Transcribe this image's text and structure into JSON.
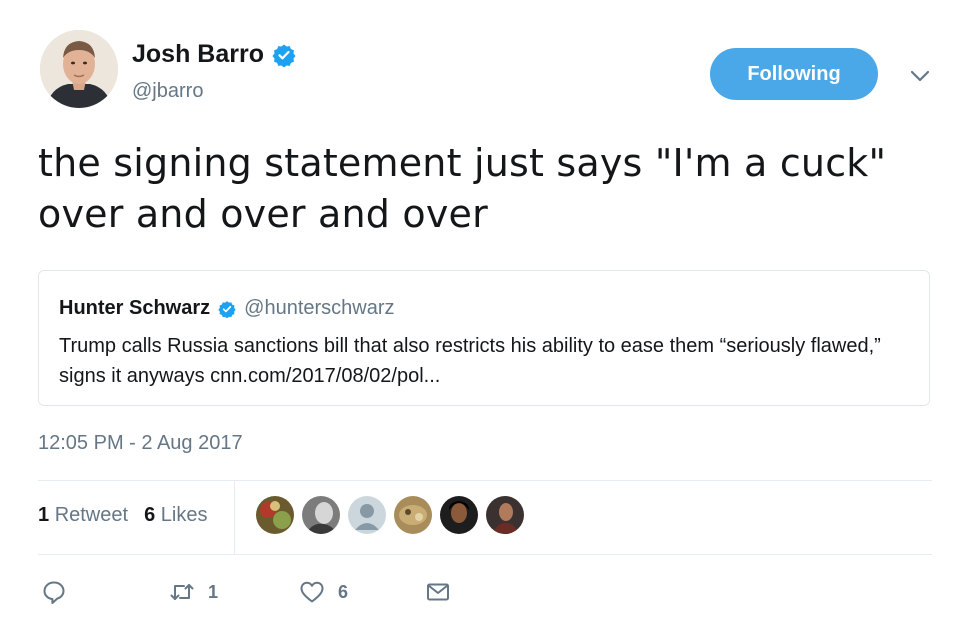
{
  "author": {
    "name": "Josh Barro",
    "handle": "@jbarro",
    "verified_icon": "verified-badge-icon",
    "avatar_icon": "profile-photo"
  },
  "follow_button": {
    "label": "Following",
    "color": "#4aa8e8"
  },
  "menu_icon": "chevron-down-icon",
  "tweet": {
    "text": "the signing statement just says \"I'm a cuck\" over and over and over"
  },
  "quoted": {
    "name": "Hunter Schwarz",
    "handle": "@hunterschwarz",
    "text": "Trump calls Russia sanctions bill that also restricts his ability to ease them “seriously flawed,” signs it anyways cnn.com/2017/08/02/pol..."
  },
  "timestamp": "12:05 PM - 2 Aug 2017",
  "stats": {
    "retweets_count": "1",
    "retweets_label": "Retweet",
    "likes_count": "6",
    "likes_label": "Likes"
  },
  "actions": {
    "reply_icon": "reply-icon",
    "retweet_icon": "retweet-icon",
    "retweet_count": "1",
    "like_icon": "heart-icon",
    "like_count": "6",
    "dm_icon": "envelope-icon"
  },
  "colors": {
    "accent": "#1da1f2",
    "muted": "#657786",
    "text": "#14171a"
  }
}
